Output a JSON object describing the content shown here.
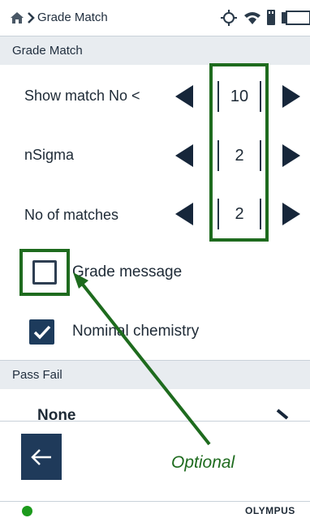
{
  "topbar": {
    "breadcrumb_title": "Grade Match",
    "icons": [
      "home-icon",
      "chevron-right-icon",
      "gps-icon",
      "wifi-icon",
      "usb-icon",
      "battery-icon"
    ]
  },
  "sections": {
    "grade_match_header": "Grade Match",
    "pass_fail_header": "Pass Fail"
  },
  "settings": {
    "show_match_label": "Show match No <",
    "show_match_value": "10",
    "nsigma_label": "nSigma",
    "nsigma_value": "2",
    "matches_label": "No of matches",
    "matches_value": "2"
  },
  "checkboxes": {
    "grade_message_label": "Grade message",
    "grade_message_checked": false,
    "nominal_chemistry_label": "Nominal chemistry",
    "nominal_chemistry_checked": true
  },
  "pass_fail": {
    "selected": "None"
  },
  "annotation": {
    "text": "Optional",
    "color": "#1e6b1e"
  },
  "footer": {
    "brand": "OLYMPUS",
    "status_color": "#1c9a1c"
  },
  "colors": {
    "accent": "#1f3a5a",
    "header_bg": "#e8ecf0"
  }
}
